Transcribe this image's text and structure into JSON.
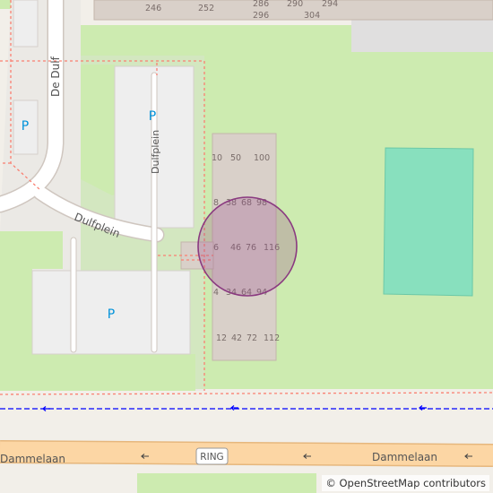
{
  "streets": {
    "de_dulf": "De Dulf",
    "dulfplein_west": "Dulfplein",
    "dulfplein_north": "Dulfplein",
    "dammelaan_left": "Dammelaan",
    "dammelaan_right": "Dammelaan",
    "ring_badge": "RING"
  },
  "parking": {
    "symbol": "P"
  },
  "house_numbers": {
    "top": [
      "246",
      "252",
      "286",
      "290",
      "294",
      "296",
      "304"
    ],
    "block": [
      "10",
      "50",
      "100",
      "8",
      "38",
      "68",
      "98",
      "6",
      "46",
      "76",
      "116",
      "4",
      "34",
      "64",
      "94",
      "12",
      "42",
      "72",
      "112"
    ]
  },
  "marker": {
    "fill": "#9b4a8c",
    "stroke": "#8a3a80"
  },
  "colors": {
    "land": "#f2efe9",
    "grass": "#cdebb0",
    "pitch": "#88e0be",
    "building": "#d9d0c9",
    "parking": "#eeeeee",
    "road_primary": "#fcd6a4",
    "footway": "#fa8072",
    "cycleway": "#0000ff"
  },
  "attribution": {
    "symbol": "©",
    "text": "OpenStreetMap contributors"
  }
}
